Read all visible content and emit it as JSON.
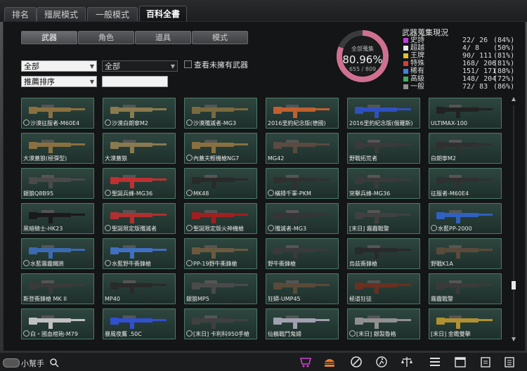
{
  "top_tabs": [
    "排名",
    "殭屍模式",
    "一般模式",
    "百科全書"
  ],
  "active_top_tab": 3,
  "sub_tabs": [
    "武器",
    "角色",
    "道具",
    "模式"
  ],
  "active_sub_tab": 0,
  "filters": {
    "category": "全部",
    "subcategory": "全部",
    "sort": "推薦排序",
    "search_value": "",
    "only_unowned_label": "查看未擁有武器"
  },
  "collection": {
    "title": "武器蒐集現況",
    "center_label": "全部蒐集",
    "percent": "80.96%",
    "count": "655 / 809",
    "fraction": 0.8096,
    "rows": [
      {
        "name": "史詩",
        "count": "22/ 26",
        "pct": "(84%)",
        "color": "#c040d8"
      },
      {
        "name": "超越",
        "count": "4/ 8",
        "pct": "(50%)",
        "color": "#e8e8e8"
      },
      {
        "name": "王牌",
        "count": "90/ 111",
        "pct": "(81%)",
        "color": "#e0c030"
      },
      {
        "name": "特殊",
        "count": "168/ 206",
        "pct": "(81%)",
        "color": "#d04040"
      },
      {
        "name": "稀有",
        "count": "151/ 171",
        "pct": "(88%)",
        "color": "#4080e0"
      },
      {
        "name": "高級",
        "count": "148/ 204",
        "pct": "(72%)",
        "color": "#40b060"
      },
      {
        "name": "一般",
        "count": "72/ 83",
        "pct": "(86%)",
        "color": "#909090"
      }
    ]
  },
  "weapons": [
    {
      "label": "沙漠征服者-M60E4",
      "locked": true,
      "color": "#8a7040"
    },
    {
      "label": "沙漠白朗寧M2",
      "locked": true,
      "color": "#8a7a50"
    },
    {
      "label": "沙漠殲滅者-MG3",
      "locked": true,
      "color": "#7a6a40"
    },
    {
      "label": "2016里約紀念版(德國)",
      "locked": false,
      "color": "#c06030"
    },
    {
      "label": "2016里約紀念版(俄羅斯)",
      "locked": false,
      "color": "#3050c0"
    },
    {
      "label": "ULTIMAX-100",
      "locked": false,
      "color": "#222222"
    },
    {
      "label": "大漠蓋狼(極彈型)",
      "locked": false,
      "color": "#8a7040"
    },
    {
      "label": "大漠蓋狼",
      "locked": false,
      "color": "#8a7a50"
    },
    {
      "label": "內蓋夫輕機槍NG7",
      "locked": true,
      "color": "#8a7040"
    },
    {
      "label": "MG42",
      "locked": false,
      "color": "#5a4a40"
    },
    {
      "label": "野戰拓荒者",
      "locked": false,
      "color": "#3a3a3a"
    },
    {
      "label": "白朗寧M2",
      "locked": false,
      "color": "#303030"
    },
    {
      "label": "銀狼Q8B95",
      "locked": false,
      "color": "#4a4a4a"
    },
    {
      "label": "聖誕兵蜂-MG36",
      "locked": true,
      "color": "#c03030"
    },
    {
      "label": "MK48",
      "locked": true,
      "color": "#2a2a2a"
    },
    {
      "label": "橫掃千軍-PKM",
      "locked": true,
      "color": "#303030"
    },
    {
      "label": "突擊兵蜂-MG36",
      "locked": false,
      "color": "#3a3a3a"
    },
    {
      "label": "征服者-M60E4",
      "locked": false,
      "color": "#303030"
    },
    {
      "label": "黑暗騎士-HK23",
      "locked": false,
      "color": "#1a1a1a"
    },
    {
      "label": "聖誕限定版殲滅者",
      "locked": true,
      "color": "#b03030"
    },
    {
      "label": "聖誕限定版火神機槍",
      "locked": true,
      "color": "#a02020"
    },
    {
      "label": "殲滅者-MG3",
      "locked": true,
      "color": "#353535"
    },
    {
      "label": "[末日] 霧霾戰警",
      "locked": false,
      "color": "#404040"
    },
    {
      "label": "水藍PP-2000",
      "locked": true,
      "color": "#3060c0"
    },
    {
      "label": "水藍霧霾鐵將",
      "locked": true,
      "color": "#3a6ab0"
    },
    {
      "label": "水藍野牛衝鋒槍",
      "locked": true,
      "color": "#4070c0"
    },
    {
      "label": "PP-19野牛衝鋒槍",
      "locked": true,
      "color": "#6a5a40"
    },
    {
      "label": "野牛衝鋒槍",
      "locked": false,
      "color": "#3a3a3a"
    },
    {
      "label": "烏茲衝鋒槍",
      "locked": false,
      "color": "#2a2a2a"
    },
    {
      "label": "野戰K1A",
      "locked": false,
      "color": "#5a4a3a"
    },
    {
      "label": "斯登衝鋒槍 MK II",
      "locked": false,
      "color": "#3a3a3a"
    },
    {
      "label": "MP40",
      "locked": false,
      "color": "#2a2a2a"
    },
    {
      "label": "銀狼MP5",
      "locked": false,
      "color": "#4a4a4a"
    },
    {
      "label": "狂蟒-UMP45",
      "locked": false,
      "color": "#5a4a3a"
    },
    {
      "label": "極道狂徒",
      "locked": false,
      "color": "#6a3020"
    },
    {
      "label": "霧霾戰警",
      "locked": false,
      "color": "#3a3a3a"
    },
    {
      "label": "白・國血棺砲-M79",
      "locked": true,
      "color": "#c0c0c0"
    },
    {
      "label": "暴風夜鷹 .50C",
      "locked": false,
      "color": "#3050d0"
    },
    {
      "label": "[末日] 卡利科950手槍",
      "locked": true,
      "color": "#404040"
    },
    {
      "label": "仙鶴戰鬥鬼婦",
      "locked": false,
      "color": "#a0a0b0"
    },
    {
      "label": "[末日] 銀製魯格",
      "locked": true,
      "color": "#909090"
    },
    {
      "label": "[末日] 金瞻雙擊",
      "locked": false,
      "color": "#b09030"
    }
  ],
  "helper_label": "小幫手",
  "bottom_icons": [
    "shop-icon",
    "burger-icon",
    "compass-icon",
    "runner-icon",
    "scale-icon",
    "checklist-icon",
    "calendar-icon",
    "clipboard-icon"
  ]
}
